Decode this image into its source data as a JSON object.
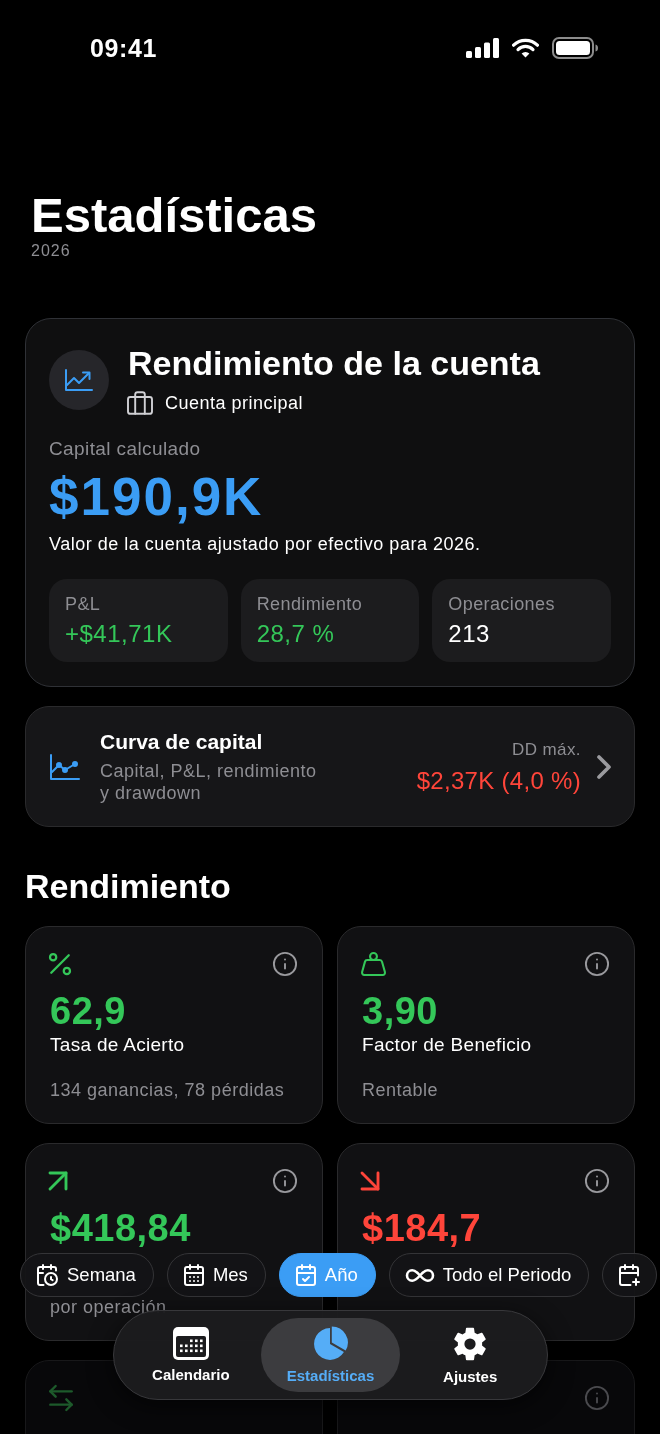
{
  "status_bar": {
    "time": "09:41"
  },
  "header": {
    "title": "Estadísticas",
    "subtitle": "2026"
  },
  "account_card": {
    "title": "Rendimiento de la cuenta",
    "account": "Cuenta principal",
    "capital_label": "Capital calculado",
    "capital_value": "$190,9K",
    "description": "Valor de la cuenta ajustado por efectivo para 2026.",
    "stats": [
      {
        "label": "P&L",
        "value": "+$41,71K",
        "color": "#34c759"
      },
      {
        "label": "Rendimiento",
        "value": "28,7 %",
        "color": "#34c759"
      },
      {
        "label": "Operaciones",
        "value": "213",
        "color": "#ffffff"
      }
    ]
  },
  "equity_curve": {
    "title": "Curva de capital",
    "subtitle": "Capital, P&L, rendimiento y drawdown",
    "drawdown_label": "DD máx.",
    "drawdown_value": "$2,37K (4,0 %)"
  },
  "performance": {
    "title": "Rendimiento",
    "metrics": [
      {
        "kind": "percent",
        "color": "#34c759",
        "info": true,
        "value": "62,9",
        "label": "Tasa de Acierto",
        "detail": "134 ganancias, 78 pérdidas"
      },
      {
        "kind": "weight",
        "color": "#34c759",
        "info": true,
        "value": "3,90",
        "label": "Factor de Beneficio",
        "detail": "Rentable"
      },
      {
        "kind": "arrow_up",
        "color": "#34c759",
        "info": true,
        "value": "$418,84",
        "detail": "por operación"
      },
      {
        "kind": "arrow_down",
        "color": "#ff453a",
        "info": true,
        "value": "$184,7"
      },
      {
        "kind": "swap",
        "color": "#1d5a2b",
        "info": false
      },
      {
        "kind": "blank",
        "info": true
      }
    ]
  },
  "period_filter": [
    {
      "kind": "week",
      "label": "Semana",
      "selected": false
    },
    {
      "kind": "month",
      "label": "Mes",
      "selected": false
    },
    {
      "kind": "year",
      "label": "Año",
      "selected": true
    },
    {
      "kind": "all",
      "label": "Todo el Periodo",
      "selected": false
    },
    {
      "kind": "custom",
      "selected": false
    }
  ],
  "tab_bar": [
    {
      "kind": "calendar",
      "label": "Calendario",
      "selected": false
    },
    {
      "kind": "stats",
      "label": "Estadísticas",
      "selected": true
    },
    {
      "kind": "settings",
      "label": "Ajustes",
      "selected": false
    }
  ]
}
